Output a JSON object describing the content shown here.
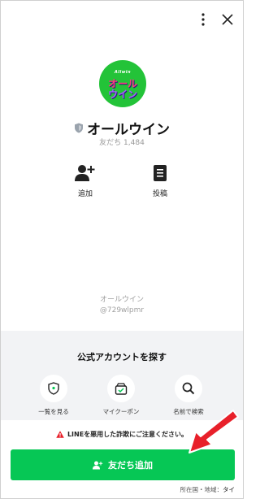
{
  "header": {
    "more_icon": "kebab-vertical-icon",
    "close_icon": "close-icon"
  },
  "profile": {
    "logo_text_top": "Allwin",
    "logo_line1": "オール",
    "logo_line2": "ウイン",
    "name": "オールウイン",
    "friends": "友だち 1,484",
    "badge_icon": "shield-badge-icon"
  },
  "actions": [
    {
      "label": "追加",
      "icon": "add-person-icon"
    },
    {
      "label": "投稿",
      "icon": "post-document-icon"
    }
  ],
  "account": {
    "name": "オールウイン",
    "id": "@729wlpmr"
  },
  "official_accounts": {
    "title": "公式アカウントを探す",
    "items": [
      {
        "label": "一覧を見る",
        "icon": "shield-list-icon"
      },
      {
        "label": "マイクーポン",
        "icon": "coupon-icon"
      },
      {
        "label": "名前で検索",
        "icon": "search-icon"
      }
    ]
  },
  "warning": {
    "text": "LINEを悪用した詐欺にご注意ください。",
    "icon": "warning-triangle-icon"
  },
  "add_friend_button": {
    "label": "友だち追加",
    "icon": "add-person-icon"
  },
  "region": {
    "label": "所在国・地域：",
    "value": "タイ"
  },
  "colors": {
    "line_green": "#06c755",
    "warning_red": "#e8202a",
    "arrow_red": "#e8202a",
    "gray_bg": "#f2f3f5"
  }
}
